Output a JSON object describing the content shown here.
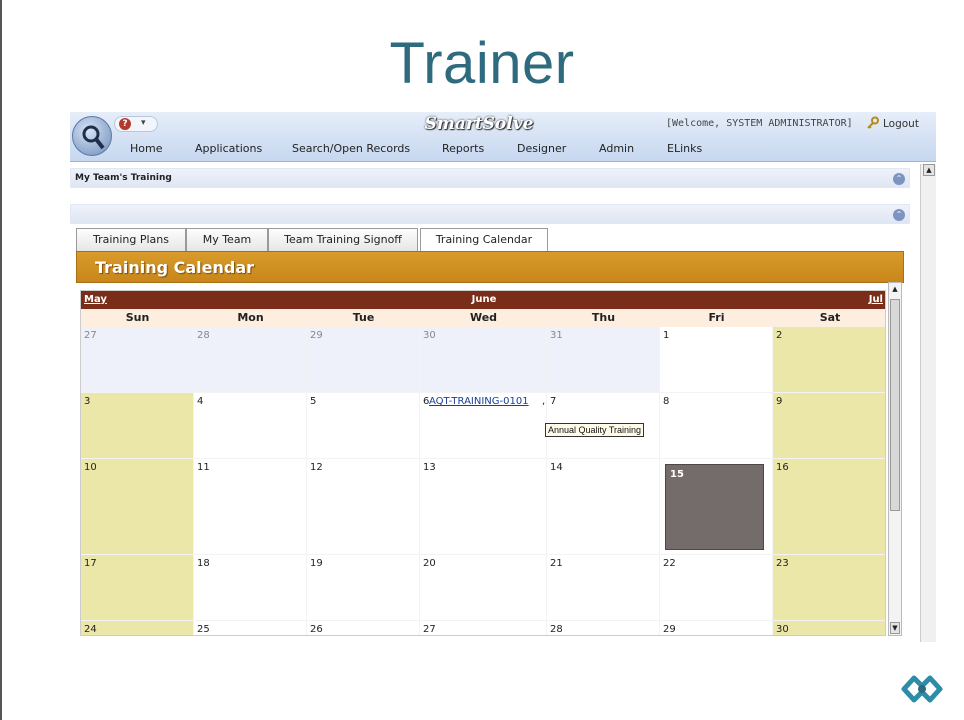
{
  "slide": {
    "title": "Trainer"
  },
  "app": {
    "brand": "SmartSolve",
    "welcome": "[Welcome, SYSTEM ADMINISTRATOR]",
    "logout": "Logout",
    "nav": [
      "Home",
      "Applications",
      "Search/Open Records",
      "Reports",
      "Designer",
      "Admin",
      "ELinks"
    ]
  },
  "panels": {
    "my_team_training": "My Team's Training"
  },
  "tabs": [
    "Training Plans",
    "My Team",
    "Team Training Signoff",
    "Training Calendar"
  ],
  "active_tab": "Training Calendar",
  "section_title": "Training Calendar",
  "calendar": {
    "prev_month": "May",
    "month": "June",
    "next_month": "Jul",
    "weekdays": [
      "Sun",
      "Mon",
      "Tue",
      "Wed",
      "Thu",
      "Fri",
      "Sat"
    ],
    "weeks": [
      [
        "27",
        "28",
        "29",
        "30",
        "31",
        "1",
        "2"
      ],
      [
        "3",
        "4",
        "5",
        "6",
        "7",
        "8",
        "9"
      ],
      [
        "10",
        "11",
        "12",
        "13",
        "14",
        "15",
        "16"
      ],
      [
        "17",
        "18",
        "19",
        "20",
        "21",
        "22",
        "23"
      ],
      [
        "24",
        "25",
        "26",
        "27",
        "28",
        "29",
        "30"
      ]
    ],
    "today": "15",
    "event": {
      "link": "AQT-TRAINING-0101",
      "separator": ",",
      "tooltip": "Annual Quality Training"
    }
  },
  "colors": {
    "title_teal": "#2f6b7e",
    "header_orange": "#d08f22",
    "month_bar": "#7a2e1a",
    "weekend": "#ebe7a8",
    "today": "#746b6b"
  }
}
